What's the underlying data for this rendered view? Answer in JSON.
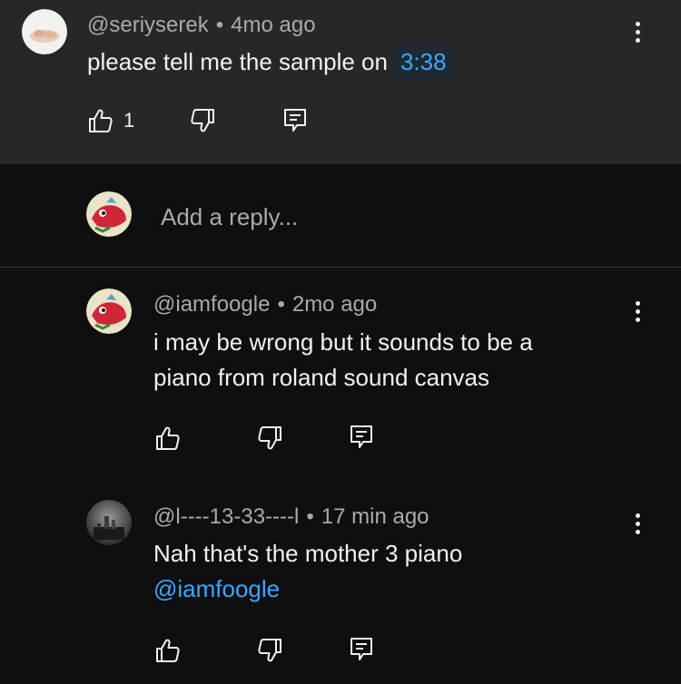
{
  "top_comment": {
    "author": "@seriyserek",
    "time": "4mo ago",
    "text": "please tell me the sample on",
    "timestamp": "3:38",
    "like_count": "1"
  },
  "reply_box": {
    "placeholder": "Add a reply..."
  },
  "replies": [
    {
      "author": "@iamfoogle",
      "time": "2mo ago",
      "text_line1": "i may be wrong but it sounds to be a",
      "text_line2": "piano from roland sound canvas"
    },
    {
      "author": "@l----13-33----l",
      "time": "17 min ago",
      "text_line1": "Nah that's the mother 3 piano",
      "mention": "@iamfoogle"
    }
  ],
  "icons": {
    "like": "thumbs-up-icon",
    "dislike": "thumbs-down-icon",
    "reply": "reply-comment-icon",
    "more": "vertical-ellipsis-icon"
  },
  "colors": {
    "link": "#3ea6ff",
    "text": "#f1f1f1",
    "meta": "#aaaaaa",
    "background": "#0f0f0f",
    "highlight_bg": "#272727"
  }
}
